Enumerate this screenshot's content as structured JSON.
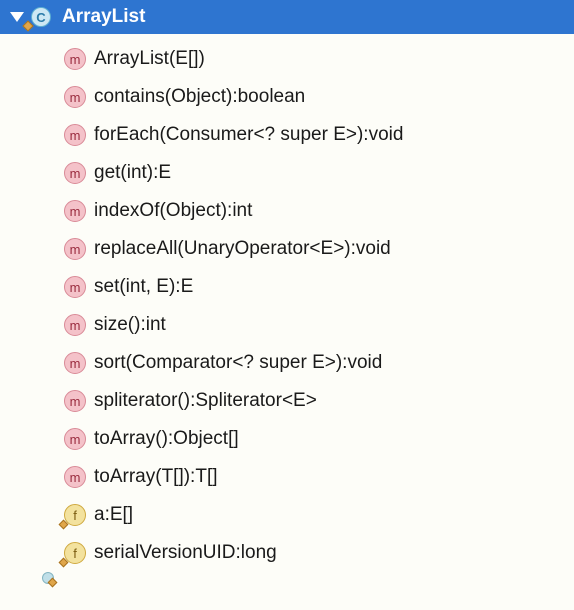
{
  "header": {
    "class_letter": "C",
    "title": "ArrayList"
  },
  "members": [
    {
      "kind": "method",
      "letter": "m",
      "signature": "ArrayList(E[])"
    },
    {
      "kind": "method",
      "letter": "m",
      "signature": "contains(Object):boolean"
    },
    {
      "kind": "method",
      "letter": "m",
      "signature": "forEach(Consumer<? super E>):void"
    },
    {
      "kind": "method",
      "letter": "m",
      "signature": "get(int):E"
    },
    {
      "kind": "method",
      "letter": "m",
      "signature": "indexOf(Object):int"
    },
    {
      "kind": "method",
      "letter": "m",
      "signature": "replaceAll(UnaryOperator<E>):void"
    },
    {
      "kind": "method",
      "letter": "m",
      "signature": "set(int, E):E"
    },
    {
      "kind": "method",
      "letter": "m",
      "signature": "size():int"
    },
    {
      "kind": "method",
      "letter": "m",
      "signature": "sort(Comparator<? super E>):void"
    },
    {
      "kind": "method",
      "letter": "m",
      "signature": "spliterator():Spliterator<E>"
    },
    {
      "kind": "method",
      "letter": "m",
      "signature": "toArray():Object[]"
    },
    {
      "kind": "method",
      "letter": "m",
      "signature": "toArray(T[]):T[]"
    },
    {
      "kind": "field",
      "letter": "f",
      "signature": "a:E[]"
    },
    {
      "kind": "field",
      "letter": "f",
      "signature": "serialVersionUID:long"
    }
  ]
}
